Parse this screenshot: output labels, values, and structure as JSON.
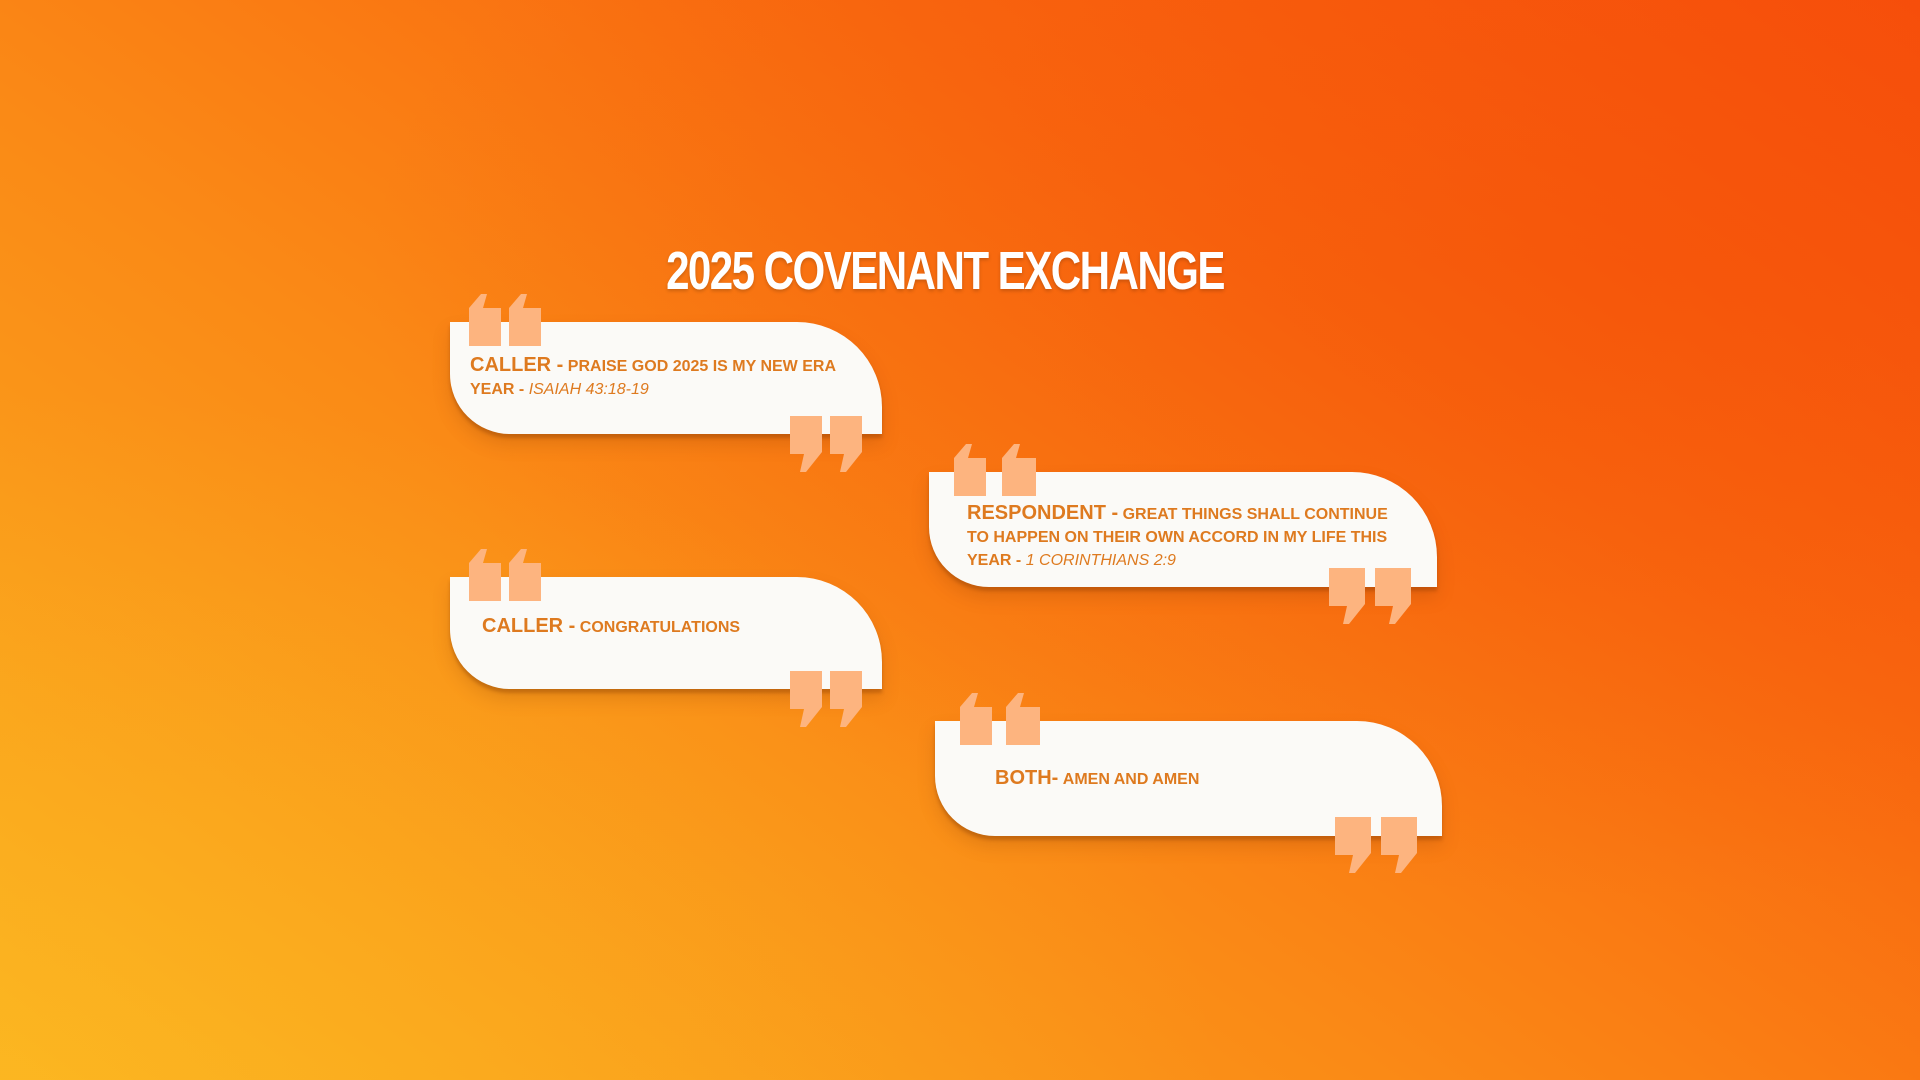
{
  "title": "2025 COVENANT EXCHANGE",
  "colors": {
    "background_start": "#f8500c",
    "background_end": "#fbb01f",
    "bubble": "#fbfaf7",
    "text": "#de7a1f",
    "quote_mark": "#fdb47f"
  },
  "icons": {
    "open_quote": "open-quote-icon",
    "close_quote": "close-quote-icon"
  },
  "bubbles": [
    {
      "speaker": "CALLER -",
      "lines": [
        "PRAISE GOD 2025 IS MY NEW ERA"
      ],
      "tail": "YEAR -",
      "reference": "ISAIAH 43:18-19"
    },
    {
      "speaker": "RESPONDENT -",
      "lines": [
        "GREAT THINGS SHALL CONTINUE",
        "TO HAPPEN  ON THEIR OWN ACCORD  IN MY LIFE THIS"
      ],
      "tail": "YEAR -",
      "reference": "1 CORINTHIANS 2:9"
    },
    {
      "speaker": "CALLER -",
      "lines": [
        "CONGRATULATIONS"
      ]
    },
    {
      "speaker": "BOTH-",
      "lines": [
        "AMEN AND AMEN"
      ]
    }
  ]
}
